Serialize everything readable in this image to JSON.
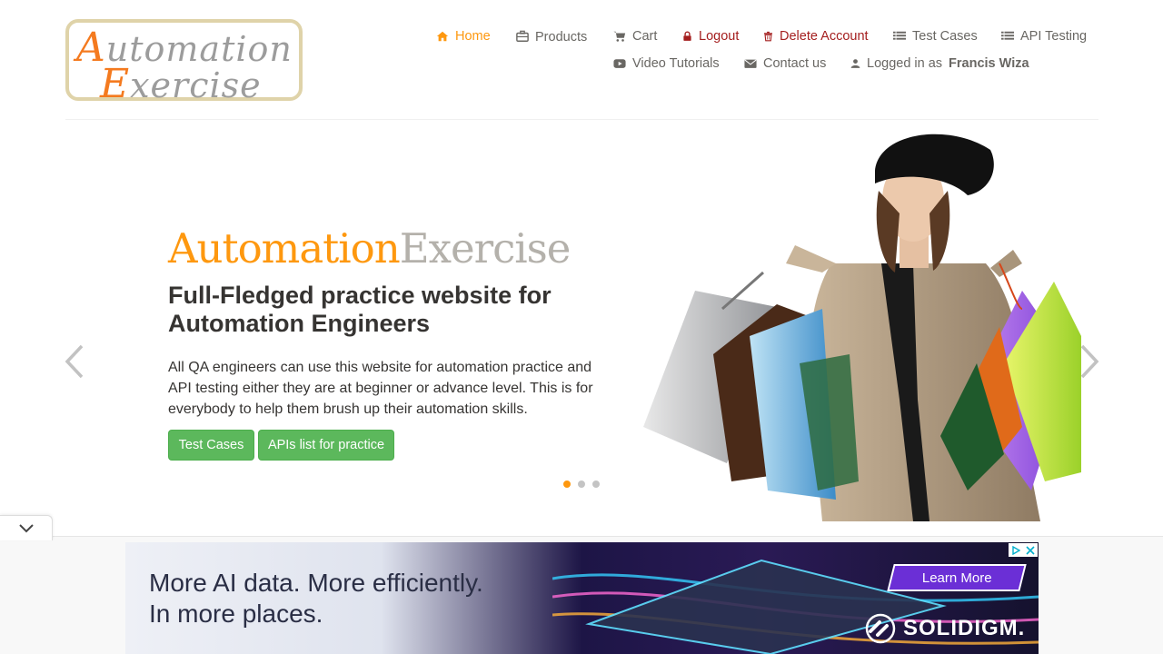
{
  "logo": {
    "line1_cap": "A",
    "line1_rest": "utomation",
    "line2_cap": "E",
    "line2_rest": "xercise"
  },
  "nav": {
    "home": "Home",
    "products": "Products",
    "cart": "Cart",
    "logout": "Logout",
    "delete_account": "Delete Account",
    "test_cases": "Test Cases",
    "api_testing": "API Testing",
    "video_tutorials": "Video Tutorials",
    "contact_us": "Contact us",
    "logged_in_prefix": "Logged in as",
    "logged_in_user": "Francis Wiza"
  },
  "hero": {
    "title_part1": "Automation",
    "title_part2": "Exercise",
    "subtitle": "Full-Fledged practice website for Automation Engineers",
    "description": "All QA engineers can use this website for automation practice and API testing either they are at beginner or advance level. This is for everybody to help them brush up their automation skills.",
    "btn_test_cases": "Test Cases",
    "btn_apis": "APIs list for practice",
    "slide_count": 3,
    "active_slide": 1
  },
  "ad": {
    "line1": "More AI data. More efficiently.",
    "line2": "In more places.",
    "cta": "Learn More",
    "brand": "SOLIDIGM."
  },
  "colors": {
    "accent": "#fe980f",
    "danger": "#a41e1e",
    "button_green": "#5cb85c",
    "text": "#696763"
  }
}
